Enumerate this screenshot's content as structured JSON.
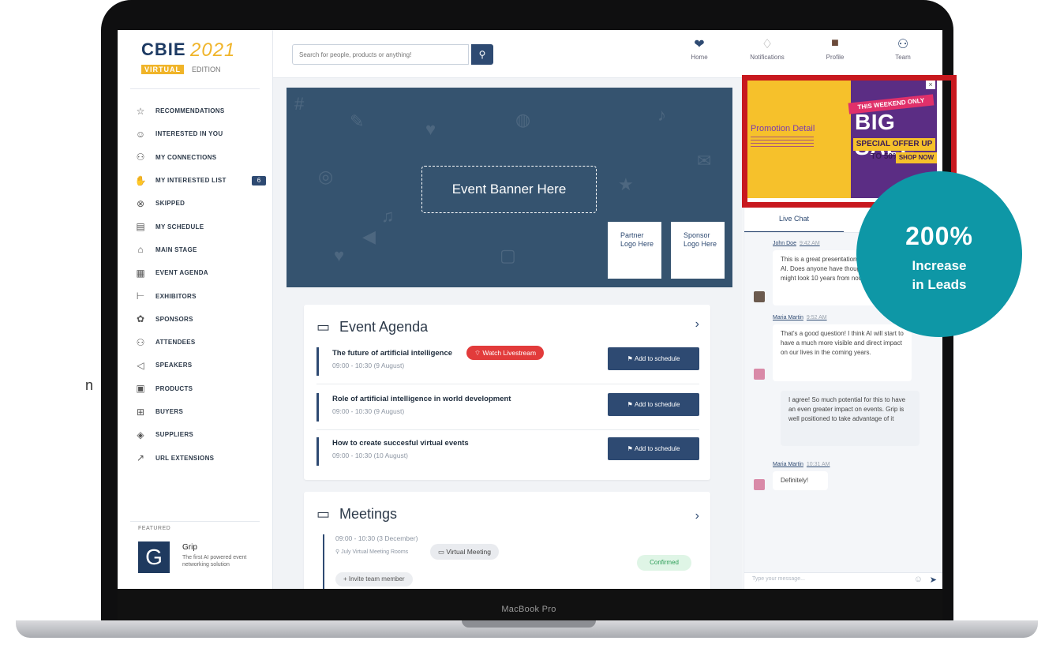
{
  "edge_text": "n",
  "device_label": "MacBook Pro",
  "logo": {
    "main": "CBIE",
    "year": "2021",
    "virtual": "VIRTUAL",
    "edition": "EDITION"
  },
  "sidebar": {
    "items": [
      {
        "label": "RECOMMENDATIONS",
        "icon": "star-icon",
        "glyph": "☆"
      },
      {
        "label": "INTERESTED IN YOU",
        "icon": "smile-icon",
        "glyph": "☺"
      },
      {
        "label": "MY CONNECTIONS",
        "icon": "connections-icon",
        "glyph": "⚇"
      },
      {
        "label": "MY INTERESTED LIST",
        "icon": "thumbs-up-icon",
        "glyph": "✋",
        "badge": "6"
      },
      {
        "label": "SKIPPED",
        "icon": "skip-icon",
        "glyph": "⊗"
      },
      {
        "label": "MY SCHEDULE",
        "icon": "schedule-icon",
        "glyph": "▤"
      },
      {
        "label": "MAIN STAGE",
        "icon": "stage-icon",
        "glyph": "⌂"
      },
      {
        "label": "EVENT AGENDA",
        "icon": "calendar-icon",
        "glyph": "▦"
      },
      {
        "label": "EXHIBITORS",
        "icon": "exhibitor-icon",
        "glyph": "⊢"
      },
      {
        "label": "SPONSORS",
        "icon": "sponsor-icon",
        "glyph": "✿"
      },
      {
        "label": "ATTENDEES",
        "icon": "attendees-icon",
        "glyph": "⚇"
      },
      {
        "label": "SPEAKERS",
        "icon": "speaker-icon",
        "glyph": "◁"
      },
      {
        "label": "PRODUCTS",
        "icon": "products-icon",
        "glyph": "▣"
      },
      {
        "label": "BUYERS",
        "icon": "buyers-icon",
        "glyph": "⊞"
      },
      {
        "label": "SUPPLIERS",
        "icon": "suppliers-icon",
        "glyph": "◈"
      },
      {
        "label": "URL EXTENSIONS",
        "icon": "link-icon",
        "glyph": "↗"
      }
    ],
    "featured_label": "FEATURED",
    "featured": {
      "logo": "G",
      "name": "Grip",
      "description": "The first AI powered event networking solution"
    }
  },
  "search": {
    "placeholder": "Search for people, products or anything!"
  },
  "topnav": [
    {
      "label": "Home",
      "icon": "home-icon",
      "glyph": "❤"
    },
    {
      "label": "Notifications",
      "icon": "bell-icon",
      "glyph": "🔔"
    },
    {
      "label": "Profile",
      "icon": "avatar-icon",
      "glyph": "▆"
    },
    {
      "label": "Team",
      "icon": "team-icon",
      "glyph": "⚇"
    }
  ],
  "banner": {
    "text": "Event Banner Here",
    "partner": "Partner Logo Here",
    "sponsor": "Sponsor Logo Here"
  },
  "agenda": {
    "title": "Event Agenda",
    "live_label": "Watch Livestream",
    "add_label": "Add to schedule",
    "items": [
      {
        "title": "The future of artificial intelligence",
        "time": "09:00 - 10:30 (9 August)"
      },
      {
        "title": "Role of artificial intelligence in world development",
        "time": "09:00 - 10:30 (9 August)"
      },
      {
        "title": "How to create succesful virtual events",
        "time": "09:00 - 10:30 (10 August)"
      }
    ]
  },
  "meetings": {
    "title": "Meetings",
    "time": "09:00 - 10:30 (3 December)",
    "location": "July Virtual Meeting Rooms",
    "chip": "Virtual Meeting",
    "status": "Confirmed",
    "invite": "+ Invite team member"
  },
  "ad": {
    "left_text": "Promotion Detail",
    "ribbon": "THIS WEEKEND ONLY",
    "headline": "BIG SALE",
    "offer": "SPECIAL OFFER UP TO 50% OFF",
    "cta": "SHOP NOW",
    "close": "×"
  },
  "chat": {
    "tab": "Live Chat",
    "messages": [
      {
        "author": "John Doe",
        "time": "9:42 AM",
        "text": "This is a great presentation on the future of AI. Does anyone have thoughts on how this might look 10 years from now?"
      },
      {
        "author": "Maria Martin",
        "time": "9:52 AM",
        "text": "That's a good question! I think AI will start to have a much more visible and direct impact on our lives in the coming years."
      },
      {
        "author": "",
        "time": "",
        "text": "I agree! So much potential for this to have an even greater impact on events. Grip is well positioned to take advantage of it"
      },
      {
        "author": "Maria Martin",
        "time": "10:31 AM",
        "text": "Definitely!"
      }
    ],
    "input_placeholder": "Type your message..."
  },
  "stat": {
    "value": "200%",
    "label_line1": "Increase",
    "label_line2": "in Leads"
  },
  "colors": {
    "brand": "#2e4a72",
    "live": "#e23b3b",
    "accent_frame": "#c8181e",
    "stat": "#0e97a6"
  }
}
